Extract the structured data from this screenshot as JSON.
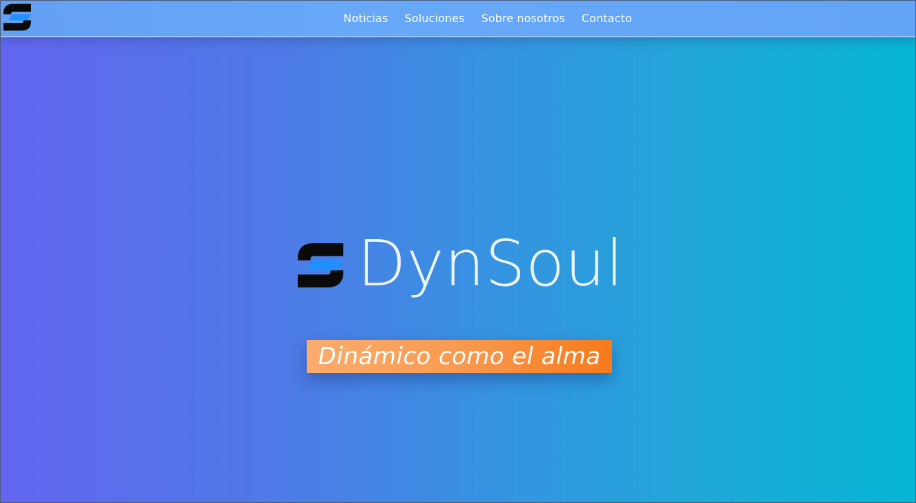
{
  "nav": {
    "logo_icon": "dynsoul-logo-icon",
    "links": [
      {
        "label": "Noticias"
      },
      {
        "label": "Soluciones"
      },
      {
        "label": "Sobre nosotros"
      },
      {
        "label": "Contacto"
      }
    ]
  },
  "hero": {
    "logo_icon": "dynsoul-logo-icon",
    "brand_name": "DynSoul",
    "tagline": "Dinámico como el alma"
  },
  "colors": {
    "gradient_start": "#6366f1",
    "gradient_end": "#06b6d4",
    "navbar": "#67a8f8",
    "logo_dark": "#0a0a0a",
    "logo_accent": "#1e90ff",
    "tagline_start": "#fbac6e",
    "tagline_end": "#f77a1c"
  }
}
